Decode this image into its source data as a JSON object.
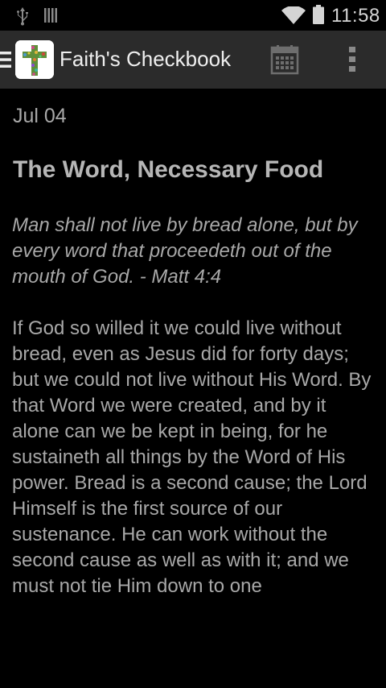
{
  "status_bar": {
    "time": "11:58",
    "usb_icon": "usb-icon",
    "signal_icon": "signal-bars-icon",
    "wifi_icon": "wifi-icon",
    "battery_icon": "battery-icon"
  },
  "action_bar": {
    "title": "Faith's Checkbook",
    "drawer_icon": "hamburger-menu-icon",
    "logo_icon": "cross-logo-icon",
    "calendar_icon": "calendar-icon",
    "overflow_icon": "more-vertical-icon",
    "background": "#2b2b2b"
  },
  "devotional": {
    "date": "Jul 04",
    "title": "The Word, Necessary Food",
    "verse": "Man shall not live by bread alone, but by every word that proceedeth out of the mouth of God. - Matt 4:4",
    "body": "If God so willed it we could live without bread, even as Jesus did for forty days; but we could not live without His Word. By that Word we were created, and by it alone can we be kept in being, for he sustaineth all things by the Word of His power. Bread is a second cause; the Lord Himself is the first source of our sustenance. He can work without the second cause as well as with it; and we must not tie Him down to one"
  }
}
